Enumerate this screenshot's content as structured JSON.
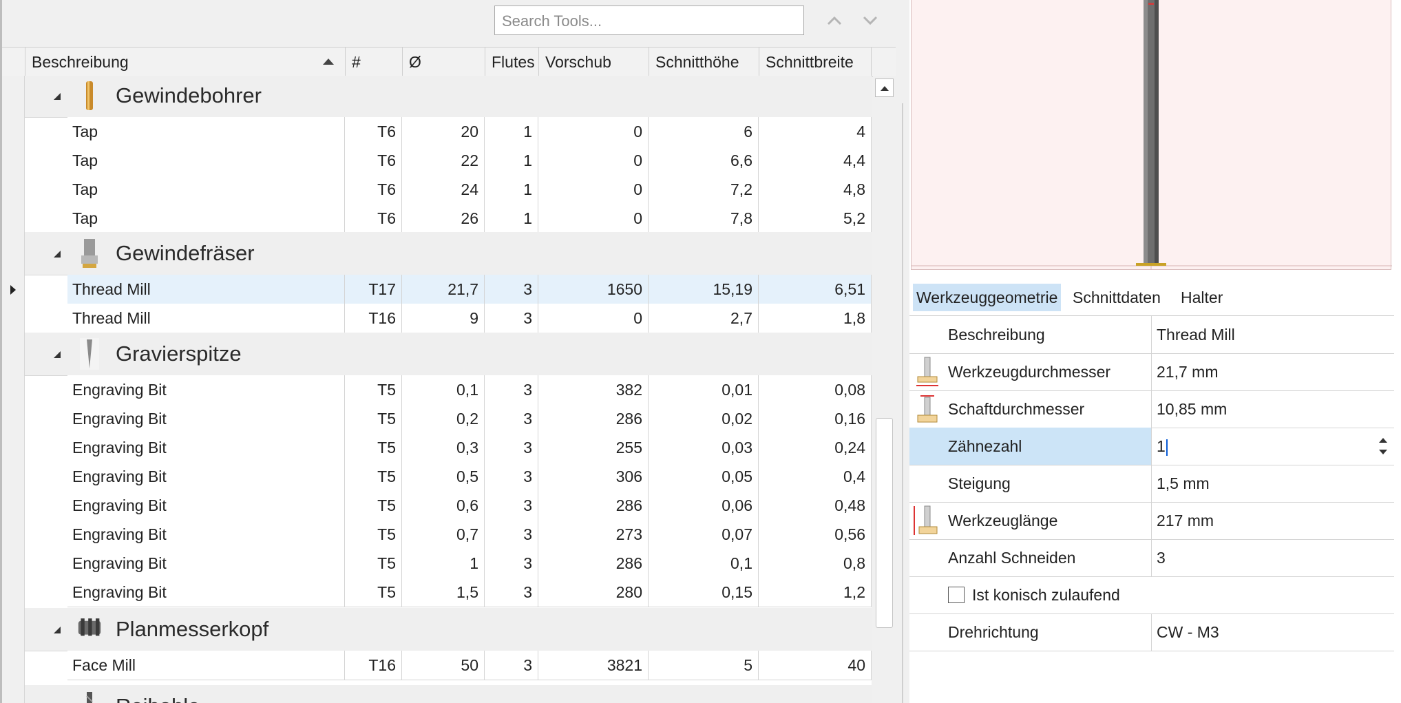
{
  "toolbar": {
    "search_placeholder": "Search Tools..."
  },
  "grid": {
    "columns": [
      "Beschreibung",
      "#",
      "Ø",
      "Flutes",
      "Vorschub",
      "Schnitthöhe",
      "Schnittbreite"
    ],
    "groups": [
      {
        "title": "Gewindebohrer",
        "icon": "tap-tool-icon",
        "rows": [
          [
            "Tap",
            "T6",
            "20",
            "1",
            "0",
            "6",
            "4"
          ],
          [
            "Tap",
            "T6",
            "22",
            "1",
            "0",
            "6,6",
            "4,4"
          ],
          [
            "Tap",
            "T6",
            "24",
            "1",
            "0",
            "7,2",
            "4,8"
          ],
          [
            "Tap",
            "T6",
            "26",
            "1",
            "0",
            "7,8",
            "5,2"
          ]
        ]
      },
      {
        "title": "Gewindefräser",
        "icon": "thread-mill-icon",
        "rows": [
          [
            "Thread Mill",
            "T17",
            "21,7",
            "3",
            "1650",
            "15,19",
            "6,51"
          ],
          [
            "Thread Mill",
            "T16",
            "9",
            "3",
            "0",
            "2,7",
            "1,8"
          ]
        ]
      },
      {
        "title": "Gravierspitze",
        "icon": "engraving-bit-icon",
        "rows": [
          [
            "Engraving Bit",
            "T5",
            "0,1",
            "3",
            "382",
            "0,01",
            "0,08"
          ],
          [
            "Engraving Bit",
            "T5",
            "0,2",
            "3",
            "286",
            "0,02",
            "0,16"
          ],
          [
            "Engraving Bit",
            "T5",
            "0,3",
            "3",
            "255",
            "0,03",
            "0,24"
          ],
          [
            "Engraving Bit",
            "T5",
            "0,5",
            "3",
            "306",
            "0,05",
            "0,4"
          ],
          [
            "Engraving Bit",
            "T5",
            "0,6",
            "3",
            "286",
            "0,06",
            "0,48"
          ],
          [
            "Engraving Bit",
            "T5",
            "0,7",
            "3",
            "273",
            "0,07",
            "0,56"
          ],
          [
            "Engraving Bit",
            "T5",
            "1",
            "3",
            "286",
            "0,1",
            "0,8"
          ],
          [
            "Engraving Bit",
            "T5",
            "1,5",
            "3",
            "280",
            "0,15",
            "1,2"
          ]
        ]
      },
      {
        "title": "Planmesserkopf",
        "icon": "face-mill-icon",
        "rows": [
          [
            "Face Mill",
            "T16",
            "50",
            "3",
            "3821",
            "5",
            "40"
          ]
        ]
      },
      {
        "title": "Reibahle",
        "icon": "reamer-icon",
        "rows": []
      }
    ]
  },
  "tabs": [
    "Werkzeuggeometrie",
    "Schnittdaten",
    "Halter"
  ],
  "properties": [
    {
      "label": "Beschreibung",
      "value": "Thread Mill"
    },
    {
      "label": "Werkzeugdurchmesser",
      "value": "21,7 mm"
    },
    {
      "label": "Schaftdurchmesser",
      "value": "10,85 mm"
    },
    {
      "label": "Zähnezahl",
      "value": "1"
    },
    {
      "label": "Steigung",
      "value": "1,5 mm"
    },
    {
      "label": "Werkzeuglänge",
      "value": "217 mm"
    },
    {
      "label": "Anzahl Schneiden",
      "value": "3"
    },
    {
      "label": "Ist konisch zulaufend",
      "value": ""
    },
    {
      "label": "Drehrichtung",
      "value": "CW - M3"
    }
  ],
  "colors": {
    "selection": "#cce4f7",
    "row_selection": "#e5f1fb",
    "preview_bg": "#fdf1f1",
    "tool_gold": "#c9a227"
  }
}
